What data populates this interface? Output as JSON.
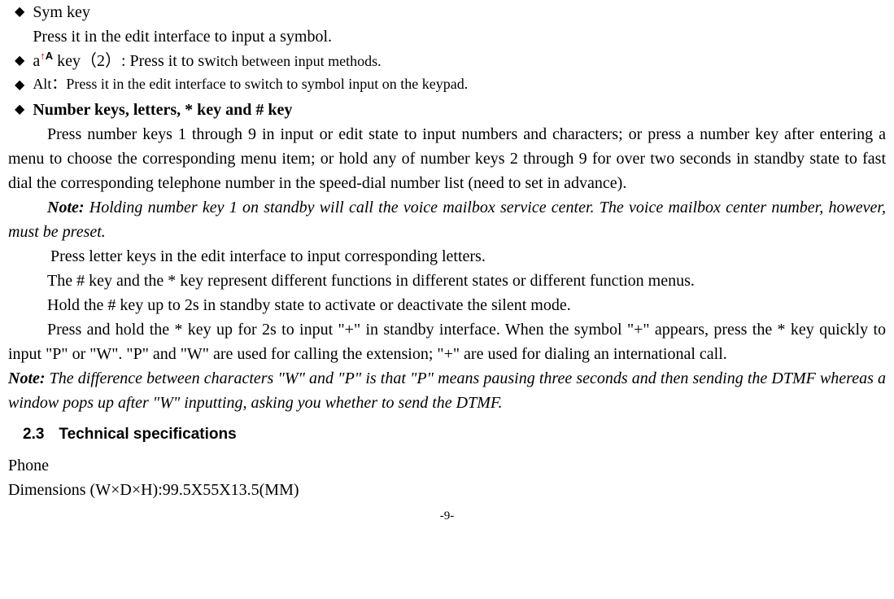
{
  "bullets": {
    "sym": {
      "title": "Sym key",
      "desc": "Press it in the edit interface to input a symbol."
    },
    "akey": {
      "prefix": "a",
      "suffix": "  key（2）: Press it to sw",
      "tail": "itch between input methods."
    },
    "alt": {
      "label": "Alt：",
      "desc": "Press it in the edit interface to switch to symbol input on the keypad."
    },
    "numkeys": {
      "title": "Number keys, letters, * key and # key"
    }
  },
  "paragraphs": {
    "p1": "Press number keys 1 through 9 in input or edit state to input numbers and characters; or press a number key after entering a menu to choose the corresponding menu item; or hold any of number keys 2 through 9 for over two seconds in standby state to fast dial the corresponding telephone number in the speed-dial number list (need to set in advance).",
    "note1_label": "Note:",
    "note1_text": " Holding number key 1 on standby will call the voice mailbox service center. The voice mailbox center number, however, must be preset.",
    "p2": "Press letter keys in the edit interface to input corresponding letters.",
    "p3": "The # key and the * key represent different functions in different states or different function menus.",
    "p4": "Hold the # key up to 2s in standby state to activate or deactivate the silent mode.",
    "p5": "Press and hold the * key up for 2s to input \"+\" in standby interface. When the symbol \"+\" appears, press the * key quickly to input \"P\" or \"W\". \"P\" and \"W\" are used for calling the extension; \"+\" are used for dialing an international call.",
    "note2_label": "Note:",
    "note2_text": " The difference between characters \"W\" and \"P\" is that \"P\" means pausing three seconds and then sending the DTMF whereas a window pops up after \"W\" inputting, asking you whether to send the DTMF."
  },
  "section": {
    "num": "2.3",
    "title": "Technical specifications"
  },
  "specs": {
    "phone": "Phone",
    "dims": "Dimensions (W×D×H):99.5X55X13.5(MM)"
  },
  "page": "-9-"
}
